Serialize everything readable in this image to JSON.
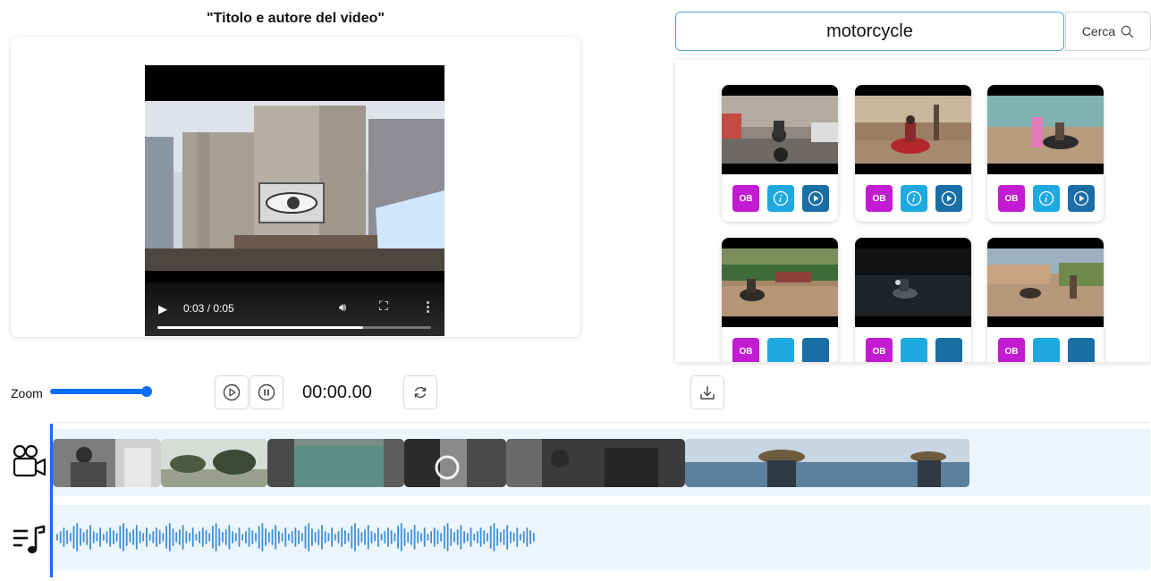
{
  "video": {
    "title": "\"Titolo e autore del video\"",
    "time_display": "0:03 / 0:05",
    "progress": 0.75
  },
  "search": {
    "query": "motorcycle",
    "button_label": "Cerca"
  },
  "results": [
    {
      "badge": "OB"
    },
    {
      "badge": "OB"
    },
    {
      "badge": "OB"
    },
    {
      "badge": "OB"
    },
    {
      "badge": "OB"
    },
    {
      "badge": "OB"
    }
  ],
  "timeline": {
    "zoom_label": "Zoom",
    "timecode": "00:00.00"
  },
  "icons": {
    "play": "play-icon",
    "pause": "pause-icon",
    "refresh": "refresh-icon",
    "download": "download-icon",
    "camera": "video-camera-icon",
    "music": "music-track-icon",
    "search": "search-icon",
    "info": "info-icon"
  },
  "colors": {
    "accent": "#0d6efd",
    "ob_button": "#c21bd1",
    "info_button": "#1ea9e1",
    "play_button": "#1a6ea6",
    "track_bg": "#edf5fc",
    "waveform": "#3e8fd6"
  }
}
